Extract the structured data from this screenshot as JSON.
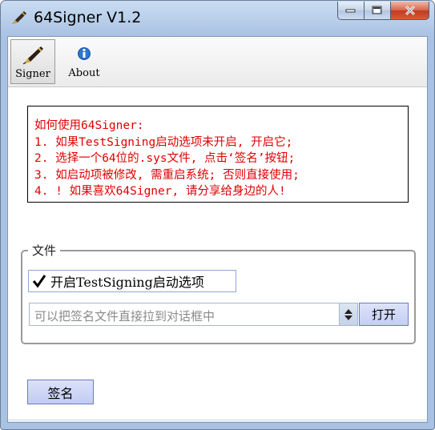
{
  "window": {
    "title": "64Signer V1.2"
  },
  "toolbar": {
    "items": [
      {
        "label": "Signer",
        "icon": "pen-icon",
        "active": true
      },
      {
        "label": "About",
        "icon": "info-icon",
        "active": false
      }
    ]
  },
  "info": {
    "lines": [
      "如何使用64Signer:",
      "1. 如果TestSigning启动选项未开启, 开启它;",
      "2. 选择一个64位的.sys文件, 点击‘签名’按钮;",
      "3. 如启动项被修改, 需重启系统; 否则直接使用;",
      "4. ! 如果喜欢64Signer, 请分享给身边的人!"
    ]
  },
  "file_group": {
    "legend": "文件",
    "testsigning_label": "开启TestSigning启动选项",
    "testsigning_checked": true,
    "file_placeholder": "可以把签名文件直接拉到对话框中",
    "open_label": "打开"
  },
  "sign_button": {
    "label": "签名"
  },
  "colors": {
    "info_text": "#e00000",
    "button_bg": "#c5cef2"
  }
}
